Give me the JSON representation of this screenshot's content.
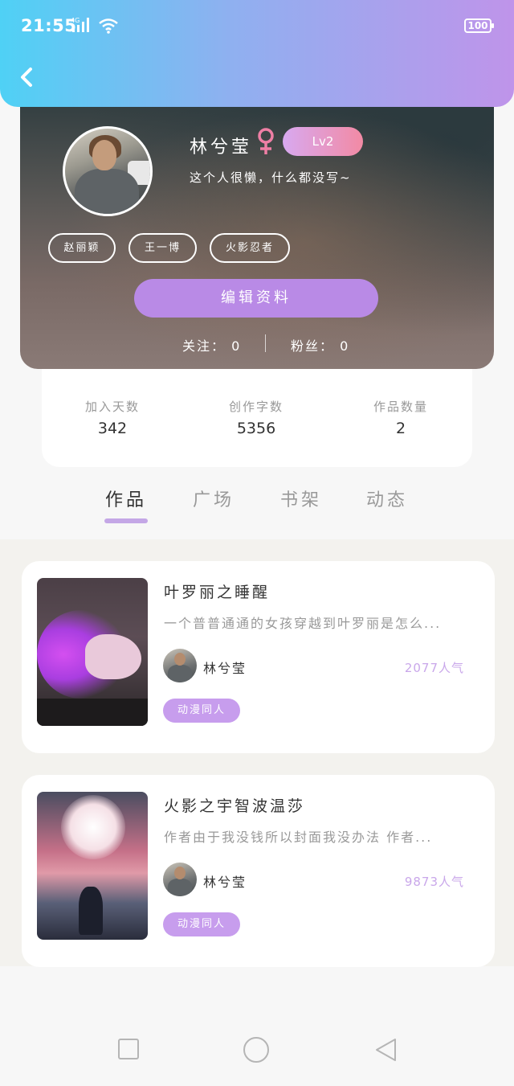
{
  "status_bar": {
    "time": "21:55",
    "network": "4G",
    "battery": "100"
  },
  "profile": {
    "name": "林兮莹",
    "level": "Lv2",
    "bio": "这个人很懒，什么都没写~",
    "tags": [
      "赵丽颖",
      "王一博",
      "火影忍者"
    ],
    "edit_label": "编辑资料",
    "follow_label": "关注：",
    "follow_count": "0",
    "fans_label": "粉丝：",
    "fans_count": "0"
  },
  "stats": [
    {
      "label": "加入天数",
      "value": "342"
    },
    {
      "label": "创作字数",
      "value": "5356"
    },
    {
      "label": "作品数量",
      "value": "2"
    }
  ],
  "tabs": [
    "作品",
    "广场",
    "书架",
    "动态"
  ],
  "works": [
    {
      "title": "叶罗丽之睡醒",
      "desc": "一个普普通通的女孩穿越到叶罗丽是怎么...",
      "author": "林兮莹",
      "popularity": "2077人气",
      "category": "动漫同人"
    },
    {
      "title": "火影之宇智波温莎",
      "desc": "作者由于我没钱所以封面我没办法 作者...",
      "author": "林兮莹",
      "popularity": "9873人气",
      "category": "动漫同人"
    }
  ],
  "icons": {
    "back": "chevron-left-icon",
    "gender": "female-icon",
    "nav": [
      "square-icon",
      "circle-icon",
      "triangle-back-icon"
    ]
  },
  "colors": {
    "accent": "#b98ae6",
    "header_start": "#4fd1f5",
    "header_end": "#bf94ea",
    "popularity": "#c9a7ea"
  }
}
